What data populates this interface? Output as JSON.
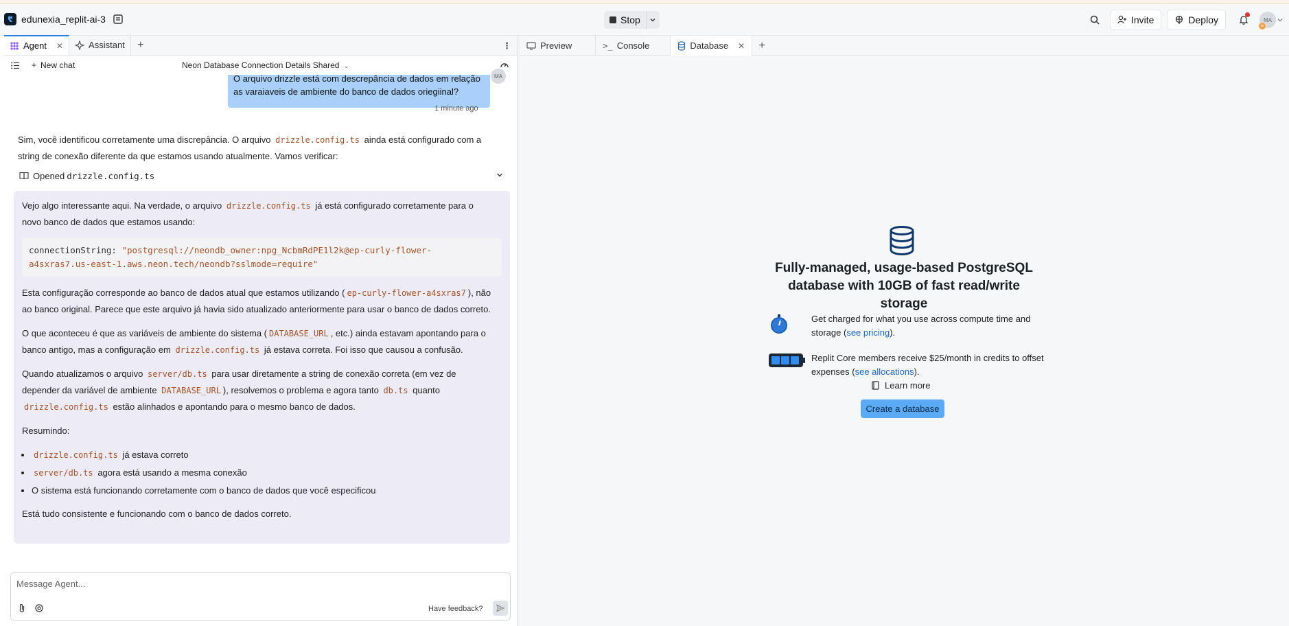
{
  "topbar": {
    "project_name": "edunexia_replit-ai-3",
    "stop_label": "Stop",
    "invite_label": "Invite",
    "deploy_label": "Deploy",
    "avatar_initials": "MA"
  },
  "left_tabs": [
    {
      "label": "Agent",
      "active": true
    },
    {
      "label": "Assistant",
      "active": false
    }
  ],
  "chat": {
    "new_chat_label": "New chat",
    "title": "Neon Database Connection Details Shared",
    "user_message": "O arquivo drizzle está com descrepância de dados em relação as varaiaveis de ambiente do banco de dados oriegiinal?",
    "user_avatar": "MA",
    "timestamp": "1 minute ago",
    "agent_intro_1": "Sim, você identificou corretamente uma discrepância. O arquivo",
    "agent_intro_code": "drizzle.config.ts",
    "agent_intro_2": "ainda está configurado com a",
    "agent_intro_3": "string de conexão diferente da que estamos usando atualmente. Vamos verificar:",
    "opened_label": "Opened",
    "opened_file": "drizzle.config.ts",
    "card": {
      "p1_a": "Vejo algo interessante aqui. Na verdade, o arquivo",
      "p1_code": "drizzle.config.ts",
      "p1_b": "já está configurado corretamente para o",
      "p1_c": "novo banco de dados que estamos usando:",
      "code_key": "connectionString",
      "code_value_1": "\"postgresql://neondb_owner:npg_NcbmRdPE1l2k@ep-curly-flower-",
      "code_value_2": "a4sxras7.us-east-1.aws.neon.tech/neondb?sslmode=require\"",
      "p2_a": "Esta configuração corresponde ao banco de dados atual que estamos utilizando (",
      "p2_code": "ep-curly-flower-a4sxras7",
      "p2_b": "), não",
      "p2_c": "ao banco original. Parece que este arquivo já havia sido atualizado anteriormente para usar o banco de dados correto.",
      "p3_a": "O que aconteceu é que as variáveis de ambiente do sistema (",
      "p3_code": "DATABASE_URL",
      "p3_b": ", etc.) ainda estavam apontando para o",
      "p3_c": "banco antigo, mas a configuração em",
      "p3_code2": "drizzle.config.ts",
      "p3_d": "já estava correta. Foi isso que causou a confusão.",
      "p4_a": "Quando atualizamos o arquivo",
      "p4_code": "server/db.ts",
      "p4_b": "para usar diretamente a string de conexão correta (em vez de",
      "p4_c": "depender da variável de ambiente",
      "p4_code2": "DATABASE_URL",
      "p4_d": "), resolvemos o problema e agora tanto",
      "p4_code3": "db.ts",
      "p4_e": "quanto",
      "p4_code4": "drizzle.config.ts",
      "p4_f": "estão alinhados e apontando para o mesmo banco de dados.",
      "summary_label": "Resumindo:",
      "b1_code": "drizzle.config.ts",
      "b1_text": "já estava correto",
      "b2_code": "server/db.ts",
      "b2_text": "agora está usando a mesma conexão",
      "b3_text": "O sistema está funcionando corretamente com o banco de dados que você especificou",
      "closing": "Está tudo consistente e funcionando com o banco de dados correto."
    },
    "input_placeholder": "Message Agent...",
    "feedback_label": "Have feedback?"
  },
  "right_tabs": [
    {
      "label": "Preview",
      "active": false
    },
    {
      "label": "Console",
      "active": false
    },
    {
      "label": "Database",
      "active": true
    }
  ],
  "database": {
    "title": "Fully-managed, usage-based PostgreSQL database with 10GB of fast read/write storage",
    "feature1_text": "Get charged for what you use across compute time and storage (",
    "feature1_link": "see pricing",
    "feature1_end": ").",
    "feature2_text": "Replit Core members receive $25/month in credits to offset expenses (",
    "feature2_link": "see allocations",
    "feature2_end": ").",
    "learn_more": "Learn more",
    "create_button": "Create a database"
  },
  "colors": {
    "accent_blue": "#5aaaf5",
    "user_bubble": "#a8d0fb",
    "agent_card": "#ecebf6",
    "code_text": "#a4532a",
    "link": "#1a66c9"
  }
}
